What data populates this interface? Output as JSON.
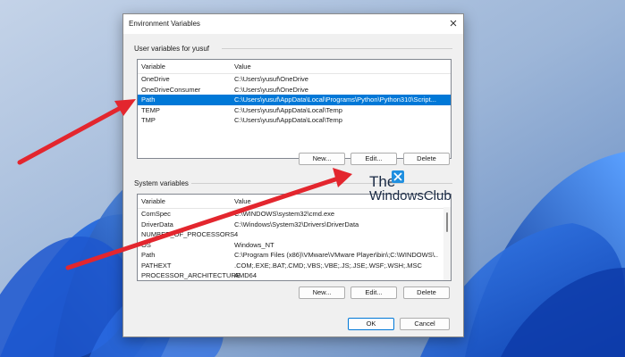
{
  "window": {
    "title": "Environment Variables"
  },
  "user_section": {
    "label": "User variables for yusuf",
    "columns": [
      "Variable",
      "Value"
    ],
    "rows": [
      {
        "variable": "OneDrive",
        "value": "C:\\Users\\yusuf\\OneDrive"
      },
      {
        "variable": "OneDriveConsumer",
        "value": "C:\\Users\\yusuf\\OneDrive"
      },
      {
        "variable": "Path",
        "value": "C:\\Users\\yusuf\\AppData\\Local\\Programs\\Python\\Python310\\Script..."
      },
      {
        "variable": "TEMP",
        "value": "C:\\Users\\yusuf\\AppData\\Local\\Temp"
      },
      {
        "variable": "TMP",
        "value": "C:\\Users\\yusuf\\AppData\\Local\\Temp"
      }
    ],
    "selected_variable": "Path",
    "buttons": {
      "new": "New...",
      "edit": "Edit...",
      "delete": "Delete"
    }
  },
  "system_section": {
    "label": "System variables",
    "columns": [
      "Variable",
      "Value"
    ],
    "rows": [
      {
        "variable": "ComSpec",
        "value": "C:\\WINDOWS\\system32\\cmd.exe"
      },
      {
        "variable": "DriverData",
        "value": "C:\\Windows\\System32\\Drivers\\DriverData"
      },
      {
        "variable": "NUMBER_OF_PROCESSORS",
        "value": "4"
      },
      {
        "variable": "OS",
        "value": "Windows_NT"
      },
      {
        "variable": "Path",
        "value": "C:\\Program Files (x86)\\VMware\\VMware Player\\bin\\;C:\\WINDOWS\\..."
      },
      {
        "variable": "PATHEXT",
        "value": ".COM;.EXE;.BAT;.CMD;.VBS;.VBE;.JS;.JSE;.WSF;.WSH;.MSC"
      },
      {
        "variable": "PROCESSOR_ARCHITECTURE",
        "value": "AMD64"
      }
    ],
    "buttons": {
      "new": "New...",
      "edit": "Edit...",
      "delete": "Delete"
    }
  },
  "footer": {
    "ok": "OK",
    "cancel": "Cancel"
  },
  "watermark": {
    "line1": "The",
    "line2": "WindowsClub"
  },
  "colors": {
    "selection": "#0078d7",
    "annotation_arrow": "#e3262e",
    "wallpaper_blue": "#1e63d9",
    "wallpaper_bg": "#a9bfdc"
  },
  "icons": {
    "close": "close-icon",
    "logo": "windowsclub-logo-icon"
  }
}
